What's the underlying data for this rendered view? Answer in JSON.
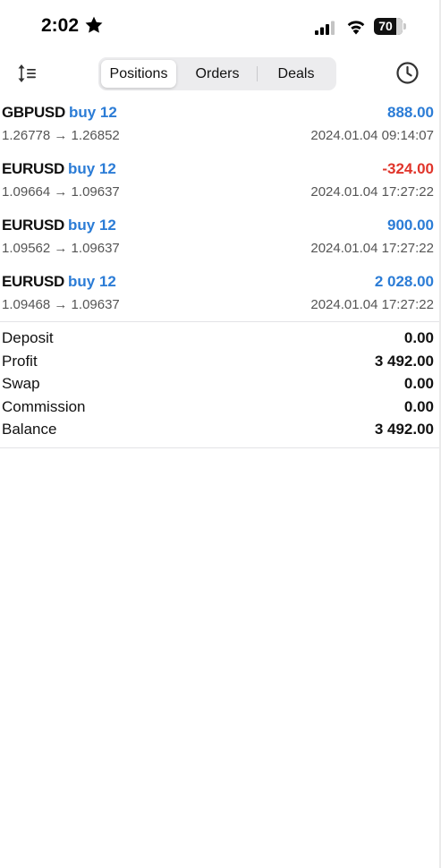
{
  "status_bar": {
    "time": "2:02",
    "battery": "70"
  },
  "toolbar": {
    "tabs": [
      {
        "label": "Positions",
        "active": true
      },
      {
        "label": "Orders",
        "active": false
      },
      {
        "label": "Deals",
        "active": false
      }
    ]
  },
  "colors": {
    "positive": "#2b7cd6",
    "negative": "#e0352b",
    "side": "#2b7cd6"
  },
  "positions": [
    {
      "symbol": "GBPUSD",
      "side": "buy 12",
      "profit": "888.00",
      "profit_sign": "positive",
      "prices": "1.26778 → 1.26852",
      "time": "2024.01.04 09:14:07"
    },
    {
      "symbol": "EURUSD",
      "side": "buy 12",
      "profit": "-324.00",
      "profit_sign": "negative",
      "prices": "1.09664 → 1.09637",
      "time": "2024.01.04 17:27:22"
    },
    {
      "symbol": "EURUSD",
      "side": "buy 12",
      "profit": "900.00",
      "profit_sign": "positive",
      "prices": "1.09562 → 1.09637",
      "time": "2024.01.04 17:27:22"
    },
    {
      "symbol": "EURUSD",
      "side": "buy 12",
      "profit": "2 028.00",
      "profit_sign": "positive",
      "prices": "1.09468 → 1.09637",
      "time": "2024.01.04 17:27:22"
    }
  ],
  "summary": [
    {
      "label": "Deposit",
      "value": "0.00"
    },
    {
      "label": "Profit",
      "value": "3 492.00"
    },
    {
      "label": "Swap",
      "value": "0.00"
    },
    {
      "label": "Commission",
      "value": "0.00"
    },
    {
      "label": "Balance",
      "value": "3 492.00"
    }
  ]
}
